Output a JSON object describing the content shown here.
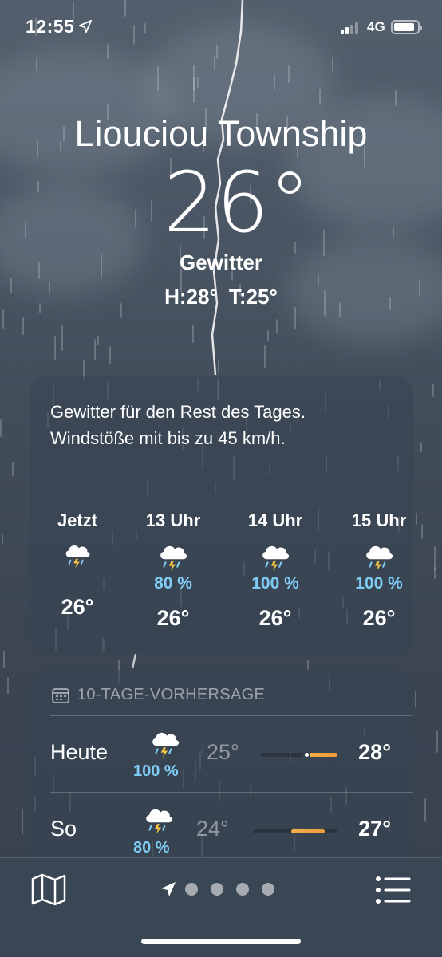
{
  "status_bar": {
    "time": "12:55",
    "network": "4G",
    "battery_level": 0.9
  },
  "weather": {
    "city": "Liouciou Township",
    "temperature": "26°",
    "condition": "Gewitter",
    "high": "H:28°",
    "low": "T:25°"
  },
  "hourly": {
    "summary_line1": "Gewitter für den Rest des Tages.",
    "summary_line2": "Windstöße mit bis zu 45 km/h.",
    "items": [
      {
        "label": "Jetzt",
        "icon": "thunderstorm-icon",
        "probability": "",
        "temp": "26°"
      },
      {
        "label": "13 Uhr",
        "icon": "thunderstorm-icon",
        "probability": "80 %",
        "temp": "26°"
      },
      {
        "label": "14 Uhr",
        "icon": "thunderstorm-icon",
        "probability": "100 %",
        "temp": "26°"
      },
      {
        "label": "15 Uhr",
        "icon": "thunderstorm-icon",
        "probability": "100 %",
        "temp": "26°"
      }
    ]
  },
  "forecast": {
    "header": "10-TAGE-VORHERSAGE",
    "header_icon": "calendar-icon",
    "days": [
      {
        "name": "Heute",
        "icon": "thunderstorm-icon",
        "probability": "100 %",
        "low": "25°",
        "high": "28°",
        "range_start": 0.55,
        "range_end": 1.0,
        "current": 0.6
      },
      {
        "name": "So",
        "icon": "thunderstorm-icon",
        "probability": "80 %",
        "low": "24°",
        "high": "27°",
        "range_start": 0.45,
        "range_end": 0.85
      }
    ]
  },
  "toolbar": {
    "map_icon": "map-icon",
    "location_icon": "location-arrow-icon",
    "list_icon": "list-icon",
    "page_count": 4
  },
  "colors": {
    "precip": "#7fcdf5",
    "temp_bar": "#f19a3a"
  }
}
